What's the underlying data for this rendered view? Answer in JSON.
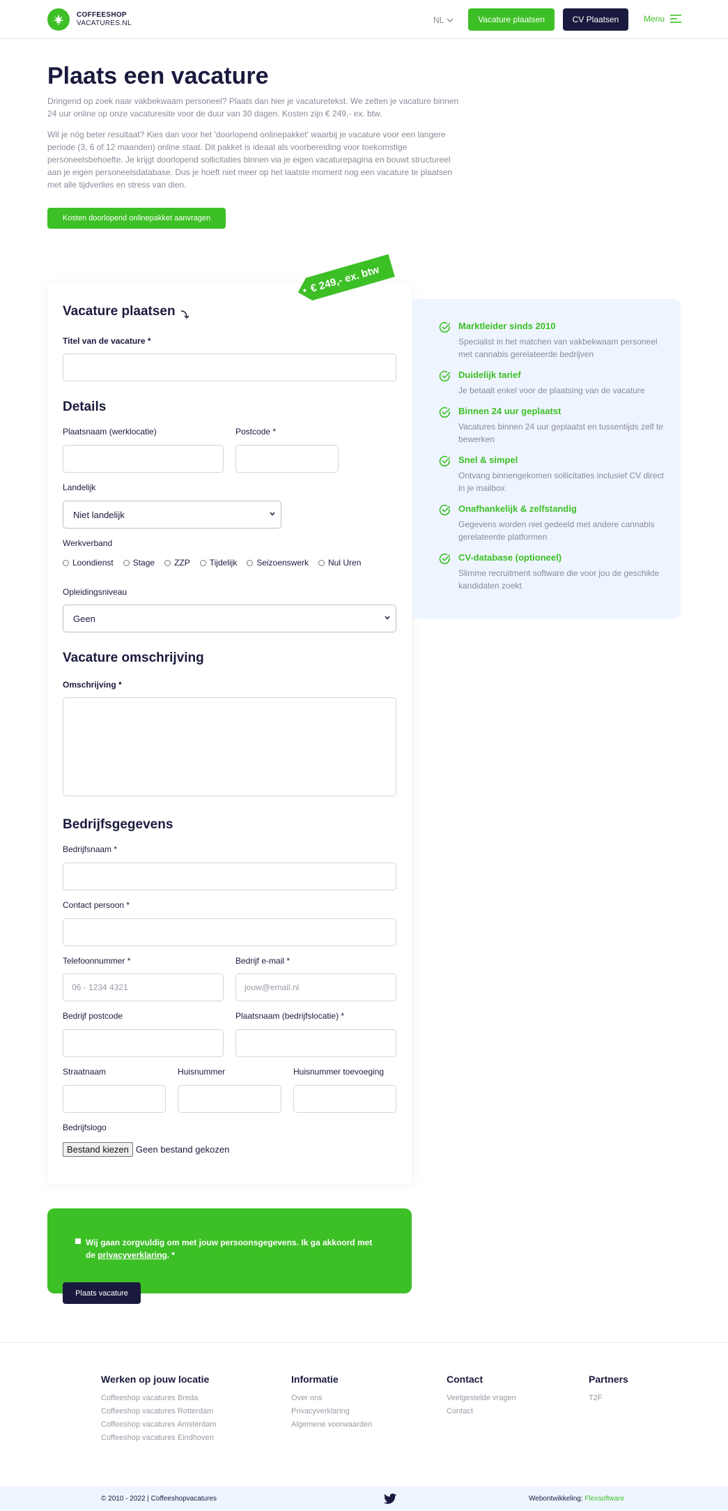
{
  "header": {
    "logo_line1": "COFFEESHOP",
    "logo_line2": "VACATURES.NL",
    "lang": "NL",
    "btn_vacature": "Vacature plaatsen",
    "btn_cv": "CV Plaatsen",
    "menu": "Menu"
  },
  "intro": {
    "title": "Plaats een vacature",
    "p1": "Dringend op zoek naar vakbekwaam personeel? Plaats dan hier je vacaturetekst. We zetten je vacature binnen 24 uur online op onze vacaturesite voor de duur van 30 dagen. Kosten zijn € 249,- ex. btw.",
    "p2": "Wil je nóg beter resultaat? Kies dan voor het 'doorlopend onlinepakket' waarbij je vacature voor een langere periode (3, 6 of 12 maanden) online staat. Dit pakket is ideaal als voorbereiding voor toekomstige personeelsbehoefte. Je krijgt doorlopend sollicitaties binnen via je eigen vacaturepagina en bouwt structureel aan je eigen personeelsdatabase. Dus je hoeft niet meer op het laatste moment nog een vacature te plaatsen met alle tijdverlies en stress van dien.",
    "button": "Kosten doorlopend onlinepakket aanvragen"
  },
  "form": {
    "price_tag": "€ 249,- ex. btw",
    "title": "Vacature plaatsen",
    "titel_label": "Titel van de vacature *",
    "details_title": "Details",
    "plaatsnaam_label": "Plaatsnaam (werklocatie)",
    "postcode_label": "Postcode *",
    "landelijk_label": "Landelijk",
    "landelijk_value": "Niet landelijk",
    "werkverband_label": "Werkverband",
    "werkverband_options": [
      "Loondienst",
      "Stage",
      "ZZP",
      "Tijdelijk",
      "Seizoenswerk",
      "Nul Uren"
    ],
    "opleiding_label": "Opleidingsniveau",
    "opleiding_value": "Geen",
    "omschrijving_title": "Vacature omschrijving",
    "omschrijving_label": "Omschrijving *",
    "bedrijf_title": "Bedrijfsgegevens",
    "bedrijfsnaam_label": "Bedrijfsnaam *",
    "contact_label": "Contact persoon *",
    "telefoon_label": "Telefoonnummer *",
    "telefoon_placeholder": "06 - 1234 4321",
    "email_label": "Bedrijf e-mail *",
    "email_placeholder": "jouw@email.nl",
    "bpostcode_label": "Bedrijf postcode",
    "bplaats_label": "Plaatsnaam (bedrijfslocatie) *",
    "straat_label": "Straatnaam",
    "huisnummer_label": "Huisnummer",
    "toevoeging_label": "Huisnummer toevoeging",
    "logo_label": "Bedrijfslogo",
    "file_button": "Bestand kiezen",
    "file_status": "Geen bestand gekozen"
  },
  "features": [
    {
      "title": "Marktleider sinds 2010",
      "desc": "Specialist in het matchen van vakbekwaam personeel met cannabis gerelateerde bedrijven"
    },
    {
      "title": "Duidelijk tarief",
      "desc": "Je betaalt enkel voor de plaatsing van de vacature"
    },
    {
      "title": "Binnen 24 uur geplaatst",
      "desc": "Vacatures binnen 24 uur geplaatst en tussentijds zelf te bewerken"
    },
    {
      "title": "Snel & simpel",
      "desc": "Ontvang binnengekomen sollicitaties inclusief CV direct in je mailbox"
    },
    {
      "title": "Onafhankelijk & zelfstandig",
      "desc": "Gegevens worden niet gedeeld met andere cannabis gerelateerde platformen"
    },
    {
      "title": "CV-database (optioneel)",
      "desc": "Slimme recruitment software die voor jou de geschikte kandidaten zoekt"
    }
  ],
  "consent": {
    "text_before": "Wij gaan zorgvuldig om met jouw persoonsgegevens. Ik ga akkoord met de ",
    "link": "privacyverklaring",
    "text_after": ". *",
    "button": "Plaats vacature"
  },
  "footer": {
    "col1_title": "Werken op jouw locatie",
    "col1_links": [
      "Coffeeshop vacatures Breda",
      "Coffeeshop vacatures Rotterdam",
      "Coffeeshop vacatures Amsterdam",
      "Coffeeshop vacatures Eindhoven"
    ],
    "col2_title": "Informatie",
    "col2_links": [
      "Over ons",
      "Privacyverklaring",
      "Algemene voorwaarden"
    ],
    "col3_title": "Contact",
    "col3_links": [
      "Veelgestelde vragen",
      "Contact"
    ],
    "col4_title": "Partners",
    "col4_links": [
      "T2F"
    ],
    "copyright": "© 2010 - 2022 | Coffeeshopvacatures",
    "dev_label": "Webontwikkeling: ",
    "dev_name": "Flexsoftware"
  },
  "colors": {
    "green": "#3dbf26",
    "navy": "#1a1a3e",
    "panel": "#eef5fe"
  },
  "icons": {
    "logo": "cannabis-leaf-icon",
    "check": "check-circle-icon",
    "twitter": "twitter-icon"
  }
}
